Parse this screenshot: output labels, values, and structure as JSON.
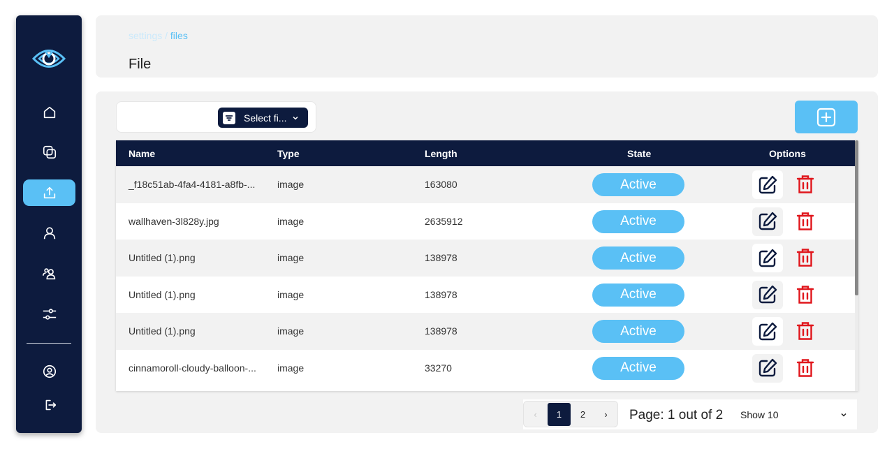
{
  "breadcrumb": {
    "parent": "settings",
    "separator": " / ",
    "current": "files"
  },
  "page_title": "File",
  "filter": {
    "label": "Select fi..."
  },
  "table": {
    "headers": {
      "name": "Name",
      "type": "Type",
      "length": "Length",
      "state": "State",
      "options": "Options"
    },
    "rows": [
      {
        "name": "_f18c51ab-4fa4-4181-a8fb-...",
        "type": "image",
        "length": "163080",
        "state": "Active"
      },
      {
        "name": "wallhaven-3l828y.jpg",
        "type": "image",
        "length": "2635912",
        "state": "Active"
      },
      {
        "name": "Untitled (1).png",
        "type": "image",
        "length": "138978",
        "state": "Active"
      },
      {
        "name": "Untitled (1).png",
        "type": "image",
        "length": "138978",
        "state": "Active"
      },
      {
        "name": "Untitled (1).png",
        "type": "image",
        "length": "138978",
        "state": "Active"
      },
      {
        "name": "cinnamoroll-cloudy-balloon-...",
        "type": "image",
        "length": "33270",
        "state": "Active"
      }
    ]
  },
  "pagination": {
    "prev": "‹",
    "pages": [
      "1",
      "2"
    ],
    "current_page": "1",
    "next": "›",
    "info": "Page: 1 out of 2",
    "show": "Show 10"
  },
  "sidebar": {
    "items": [
      "home-icon",
      "windows-icon",
      "upload-icon",
      "user-icon",
      "users-icon",
      "sliders-icon"
    ],
    "active_item": "upload-icon",
    "bottom_items": [
      "account-circle-icon",
      "logout-icon"
    ]
  },
  "colors": {
    "navy": "#0d1b3e",
    "accent": "#5ac0f5",
    "delete": "#e0161c",
    "panel": "#f2f2f2"
  }
}
